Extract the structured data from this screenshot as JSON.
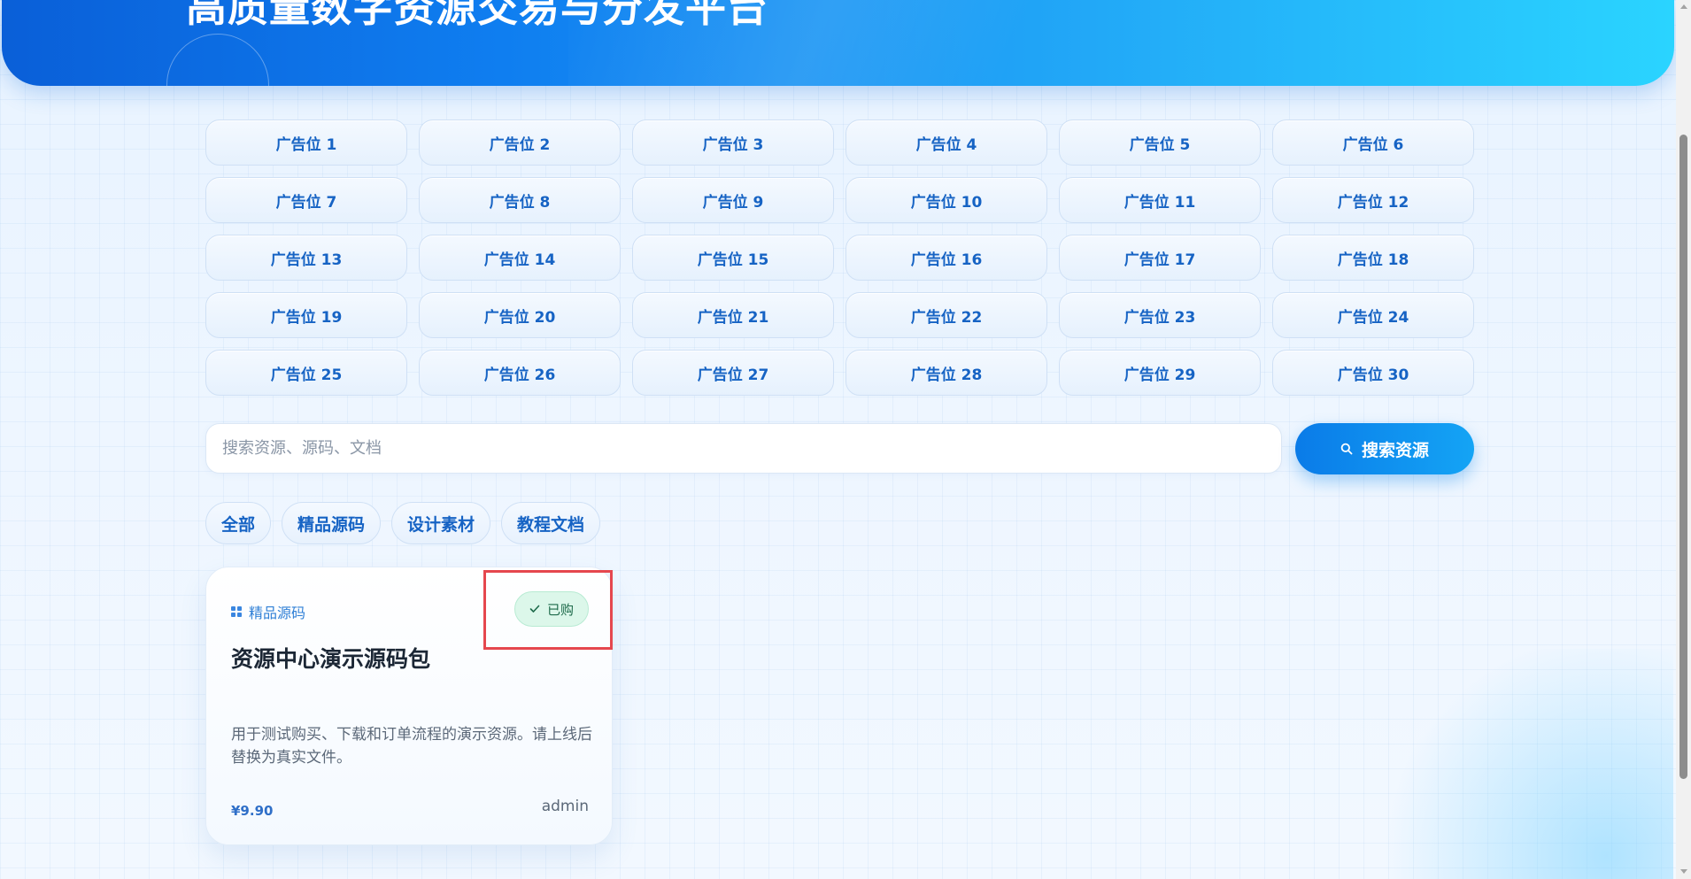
{
  "hero": {
    "title": "高质量数字资源交易与分发平台"
  },
  "ads": [
    "广告位 1",
    "广告位 2",
    "广告位 3",
    "广告位 4",
    "广告位 5",
    "广告位 6",
    "广告位 7",
    "广告位 8",
    "广告位 9",
    "广告位 10",
    "广告位 11",
    "广告位 12",
    "广告位 13",
    "广告位 14",
    "广告位 15",
    "广告位 16",
    "广告位 17",
    "广告位 18",
    "广告位 19",
    "广告位 20",
    "广告位 21",
    "广告位 22",
    "广告位 23",
    "广告位 24",
    "广告位 25",
    "广告位 26",
    "广告位 27",
    "广告位 28",
    "广告位 29",
    "广告位 30"
  ],
  "search": {
    "placeholder": "搜索资源、源码、文档",
    "value": "",
    "button_label": "搜索资源",
    "button_icon": "search-icon"
  },
  "categories": [
    "全部",
    "精品源码",
    "设计素材",
    "教程文档"
  ],
  "resource_card": {
    "category": "精品源码",
    "category_icon": "grid-icon",
    "badge": "已购",
    "badge_icon": "check-icon",
    "title": "资源中心演示源码包",
    "description": "用于测试购买、下载和订单流程的演示资源。请上线后替换为真实文件。",
    "price": "¥9.90",
    "author": "admin"
  },
  "colors": {
    "accent": "#1663c4",
    "hero_start": "#0a5fd8",
    "hero_end": "#2ad4ff",
    "badge_bg": "#dcf7ea",
    "highlight": "#e5474e"
  }
}
